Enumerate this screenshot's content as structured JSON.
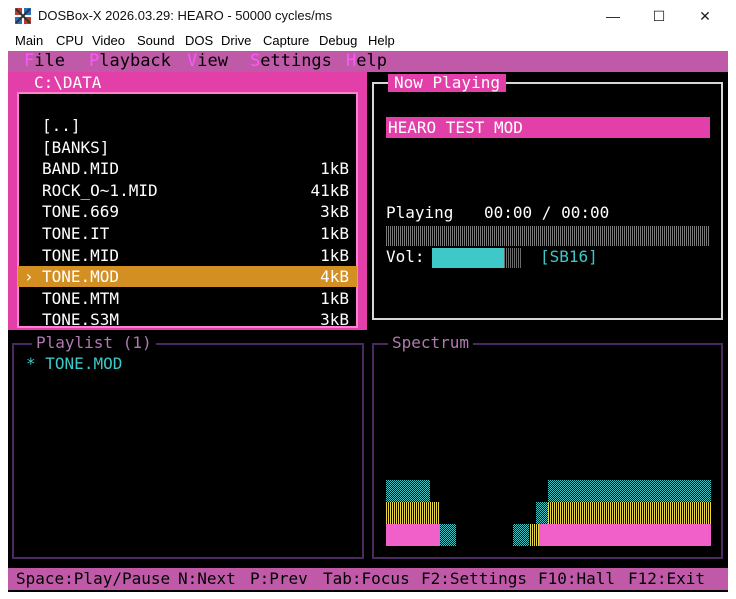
{
  "window": {
    "title": "DOSBox-X 2026.03.29: HEARO - 50000 cycles/ms",
    "minimize_glyph": "—",
    "maximize_glyph": "☐",
    "close_glyph": "✕"
  },
  "emulator_menu": [
    "Main",
    "CPU",
    "Video",
    "Sound",
    "DOS",
    "Drive",
    "Capture",
    "Debug",
    "Help"
  ],
  "app_menu": [
    {
      "hotkey": "F",
      "rest": "ile"
    },
    {
      "hotkey": "P",
      "rest": "layback"
    },
    {
      "hotkey": "V",
      "rest": "iew"
    },
    {
      "hotkey": "S",
      "rest": "ettings"
    },
    {
      "hotkey": "H",
      "rest": "elp"
    }
  ],
  "browser": {
    "title": "C:\\DATA",
    "selected_marker": "›",
    "items": [
      {
        "name": "[..]",
        "size": ""
      },
      {
        "name": "[BANKS]",
        "size": ""
      },
      {
        "name": "BAND.MID",
        "size": "1kB"
      },
      {
        "name": "ROCK_O~1.MID",
        "size": "41kB"
      },
      {
        "name": "TONE.669",
        "size": "3kB"
      },
      {
        "name": "TONE.IT",
        "size": "1kB"
      },
      {
        "name": "TONE.MID",
        "size": "1kB"
      },
      {
        "name": "TONE.MOD",
        "size": "4kB"
      },
      {
        "name": "TONE.MTM",
        "size": "1kB"
      },
      {
        "name": "TONE.S3M",
        "size": "3kB"
      }
    ],
    "selected_index": 7
  },
  "now_playing": {
    "title": "Now Playing",
    "song": "HEARO TEST MOD",
    "status": "Playing",
    "time": "00:00 / 00:00",
    "progress": 0,
    "volume_label": "Vol:",
    "volume_level": 0.8,
    "device": "[SB16]"
  },
  "playlist": {
    "title": "Playlist (1)",
    "items": [
      {
        "marker": "*",
        "name": "TONE.MOD"
      }
    ]
  },
  "spectrum": {
    "title": "Spectrum"
  },
  "status_bar": [
    "Space:Play/Pause",
    "N:Next",
    "P:Prev",
    "Tab:Focus",
    "F2:Settings",
    "F10:Hall",
    "F12:Exit"
  ],
  "colors": {
    "accent_magenta": "#e23fa8",
    "menu_bar": "#c05aa8",
    "selection": "#d38f22",
    "cyan": "#3ec8c8",
    "yellow": "#e8d84a",
    "pink": "#f060c8",
    "frame_dim": "#4a2a60"
  }
}
